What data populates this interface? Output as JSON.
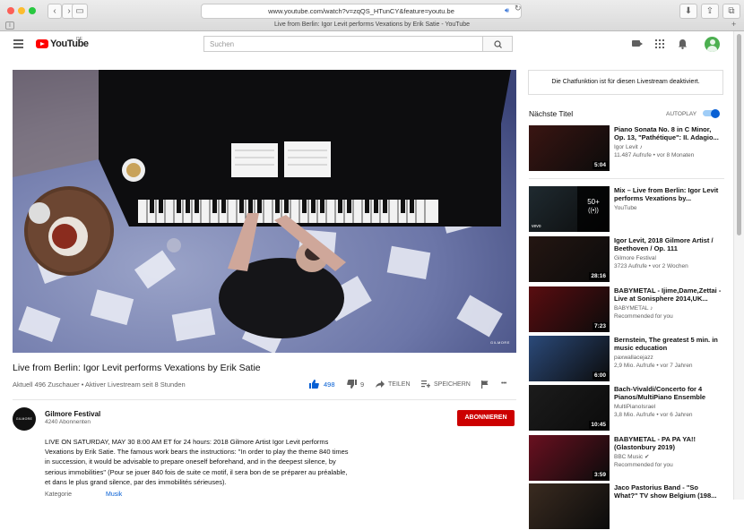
{
  "browser": {
    "url": "www.youtube.com/watch?v=zqQS_HTunCY&feature=youtu.be",
    "tab_title": "Live from Berlin: Igor Levit performs Vexations by Erik Satie - YouTube",
    "abp_label": "ABP"
  },
  "header": {
    "logo_text": "YouTube",
    "logo_region": "DE",
    "search_placeholder": "Suchen"
  },
  "video": {
    "title": "Live from Berlin: Igor Levit performs Vexations by Erik Satie",
    "viewers": "Aktuell 496 Zuschauer • Aktiver Livestream seit 8 Stunden",
    "likes": "498",
    "dislikes": "9",
    "share_label": "TEILEN",
    "save_label": "SPEICHERN",
    "more_label": "•••",
    "watermark": "GILMORE"
  },
  "channel": {
    "name": "Gilmore Festival",
    "subscribers": "4240 Abonnenten",
    "avatar_text": "GILMORE",
    "subscribe_label": "ABONNIEREN",
    "description": "LIVE ON SATURDAY, MAY 30 8:00 AM ET for 24 hours: 2018 Gilmore Artist Igor Levit performs Vexations by Erik Satie. The famous work bears the instructions: \"In order to play the theme 840 times in succession, it would be advisable to prepare oneself beforehand, and in the deepest silence, by serious immobilities\" (Pour se jouer 840 fois de suite ce motif, il sera bon de se préparer au préalable, et dans le plus grand silence, par des immobilités sérieuses).",
    "category_label": "Kategorie",
    "category_value": "Musik"
  },
  "chat": {
    "disabled_text": "Die Chatfunktion ist für diesen Livestream deaktiviert."
  },
  "sidebar": {
    "up_next": "Nächste Titel",
    "autoplay_label": "AUTOPLAY",
    "autoplay_on": true,
    "items": [
      {
        "title": "Piano Sonata No. 8 in C Minor, Op. 13, \"Pathétique\": II. Adagio...",
        "channel": "Igor Levit ♪",
        "meta": "11.487 Aufrufe • vor 8 Monaten",
        "duration": "5:04",
        "color": "#3a1512"
      },
      {
        "title": "Mix – Live from Berlin: Igor Levit performs Vexations by...",
        "channel": "YouTube",
        "meta": "",
        "duration": "",
        "overlay_count": "50+",
        "vevo": "vevo",
        "color": "#1f2a30"
      },
      {
        "title": "Igor Levit, 2018 Gilmore Artist / Beethoven / Op. 111",
        "channel": "Gilmore Festival",
        "meta": "3723 Aufrufe • vor 2 Wochen",
        "duration": "28:16",
        "color": "#241612"
      },
      {
        "title": "BABYMETAL - Ijime,Dame,Zettai - Live at Sonisphere 2014,UK...",
        "channel": "BABYMETAL ♪",
        "meta": "Recommended for you",
        "duration": "7:23",
        "color": "#5a0d10"
      },
      {
        "title": "Bernstein, The greatest 5 min. in music education",
        "channel": "paxwallacejazz",
        "meta": "2,9 Mio. Aufrufe • vor 7 Jahren",
        "duration": "6:00",
        "color": "#2b4a7a"
      },
      {
        "title": "Bach-Vivaldi/Concerto for 4 Pianos/MultiPiano Ensemble",
        "channel": "MultiPianoIsrael",
        "meta": "3,8 Mio. Aufrufe • vor 6 Jahren",
        "duration": "10:45",
        "color": "#1c1c1c"
      },
      {
        "title": "BABYMETAL - PA PA YA!! (Glastonbury 2019)",
        "channel": "BBC Music ✔",
        "meta": "Recommended for you",
        "duration": "3:59",
        "color": "#6a1020"
      },
      {
        "title": "Jaco Pastorius Band - \"So What?\" TV show Belgium (198...",
        "channel": "",
        "meta": "",
        "duration": "",
        "color": "#3a2b20"
      }
    ]
  },
  "colors": {
    "youtube_red": "#ff0000",
    "subscribe_red": "#cc0000",
    "link_blue": "#065fd4",
    "autoplay_blue": "#3ea6ff"
  }
}
